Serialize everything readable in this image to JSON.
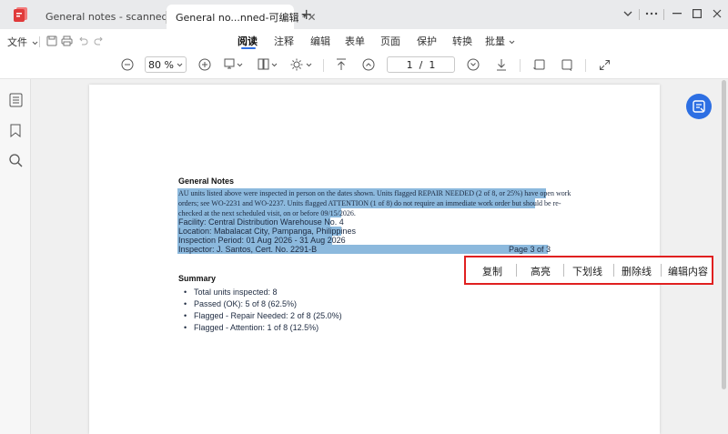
{
  "tabs": [
    {
      "label": "General notes - scanned"
    },
    {
      "label": "General no...nned-可编辑 *",
      "close": "✕"
    }
  ],
  "new_tab": "+",
  "menu": {
    "file": "文件",
    "tabs": [
      "阅读",
      "注释",
      "编辑",
      "表单",
      "页面",
      "保护",
      "转换",
      "批量"
    ],
    "active": "阅读"
  },
  "toolbar": {
    "zoom": "80 %",
    "page": "1  /  1"
  },
  "document": {
    "heading": "General Notes",
    "para_lines": [
      "AU units listed above were inspected in person on the dates shown. Units flagged REPAIR NEEDED (2 of 8, or 25%) have open work",
      "orders; see WO-2231 and WO-2237. Units flagged ATTENTION (1 of 8) do not require an immediate work order but should be re-",
      "checked at the next scheduled visit, on or before 09/15/2026."
    ],
    "facility": "Facility: Central Distribution Warehouse No. 4",
    "location": "Location: Mabalacat City, Pampanga, Philippines",
    "period": "Inspection Period: 01 Aug 2026 - 31 Aug 2026",
    "inspector": "Inspector: J. Santos, Cert. No. 2291-B",
    "page_label": "Page 3 of 3",
    "summary_title": "Summary",
    "summary_items": [
      "Total units inspected: 8",
      "Passed (OK): 5 of 8 (62.5%)",
      "Flagged - Repair Needed: 2 of 8 (25.0%)",
      "Flagged - Attention: 1 of 8 (12.5%)"
    ]
  },
  "context_menu": [
    "复制",
    "高亮",
    "下划线",
    "删除线",
    "编辑内容"
  ],
  "colors": {
    "accent": "#2f6fe4",
    "selection": "#8cb9dd",
    "popup_border": "#e02020"
  }
}
